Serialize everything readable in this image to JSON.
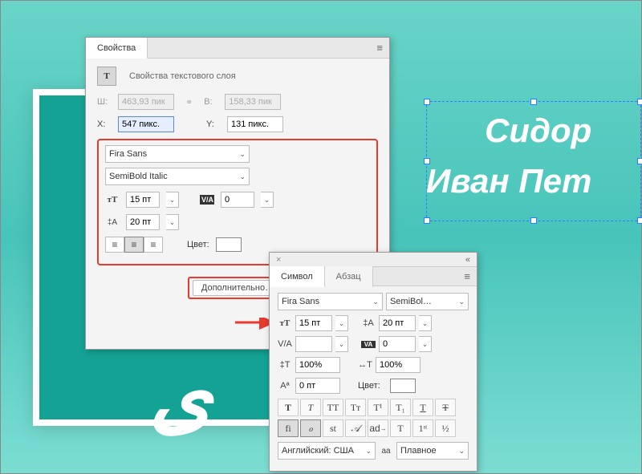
{
  "canvas": {
    "sample_line1": "Сидор",
    "sample_line2": "Иван Пет"
  },
  "properties_panel": {
    "tab_title": "Свойства",
    "section_title": "Свойства текстового слоя",
    "width_label": "Ш:",
    "width_value": "463,93 пик",
    "height_label": "В:",
    "height_value": "158,33 пик",
    "x_label": "X:",
    "x_value": "547 пикс.",
    "y_label": "Y:",
    "y_value": "131 пикс.",
    "font_family": "Fira Sans",
    "font_style": "SemiBold Italic",
    "font_size": "15 пт",
    "tracking": "0",
    "leading": "20 пт",
    "color_label": "Цвет:",
    "more_button": "Дополнительно…"
  },
  "character_panel": {
    "tab_symbol": "Символ",
    "tab_paragraph": "Абзац",
    "font_family": "Fira Sans",
    "font_style": "SemiBol…",
    "font_size": "15 пт",
    "leading": "20 пт",
    "kerning": "",
    "tracking": "0",
    "vscale": "100%",
    "hscale": "100%",
    "baseline": "0 пт",
    "color_label": "Цвет:",
    "language": "Английский: США",
    "aa_label": "aa",
    "aa_value": "Плавное",
    "opentype": {
      "fi": "fi",
      "o_slash": "ℴ",
      "st": "st",
      "script_a": "𝒜",
      "ad_arrow": "ad",
      "t_sub": "T",
      "first": "1ˢᵗ",
      "half": "½"
    },
    "styles": {
      "bold": "T",
      "italic": "T",
      "caps": "TT",
      "small": "Tᴛ",
      "super": "T¹",
      "sub": "T₁",
      "under": "T",
      "strike": "T"
    }
  }
}
